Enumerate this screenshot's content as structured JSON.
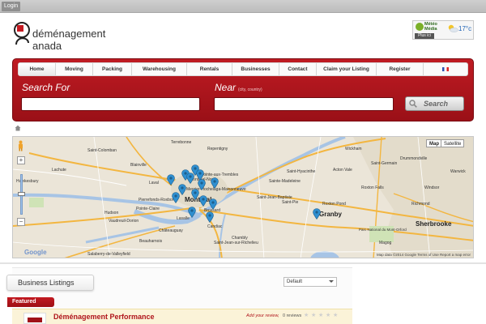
{
  "topbar": {
    "login_label": "Login"
  },
  "logo": {
    "line1": "déménagement",
    "line2": "anada"
  },
  "weather": {
    "brand": "Météo Média",
    "place": "Plus ici",
    "temperature": "17°c",
    "icon": "sun-cloud-icon"
  },
  "nav": {
    "items": [
      {
        "label": "Home",
        "active": true
      },
      {
        "label": "Moving",
        "active": false
      },
      {
        "label": "Packing",
        "active": false
      },
      {
        "label": "Warehousing",
        "active": false
      },
      {
        "label": "Rentals",
        "active": false
      },
      {
        "label": "Businesses",
        "active": false
      },
      {
        "label": "Contact",
        "active": false
      },
      {
        "label": "Claim your Listing",
        "active": false
      },
      {
        "label": "Register",
        "active": false
      }
    ],
    "language_icon": "french-flag-icon"
  },
  "search": {
    "search_for_label": "Search For",
    "search_for_value": "",
    "near_label": "Near",
    "near_hint": "(city, country)",
    "near_value": "",
    "button_label": "Search"
  },
  "map": {
    "type_map": "Map",
    "type_satellite": "Satellite",
    "selected_type": "Map",
    "footer": "Map data ©2014 Google    Terms of Use    Report a map error",
    "places": {
      "saint_colomban": "Saint-Colomban",
      "terrebonne": "Terrebonne",
      "repentigny": "Repentigny",
      "blainville": "Blainville",
      "lachute": "Lachute",
      "pointe_aux_trembles": "Pointe-aux-Trembles",
      "hawkesbury": "Hawkesbury",
      "laval": "Laval",
      "montreal_nord": "Montréal-Nord",
      "mercier": "Mercier-Hochelaga-Maisonneuve",
      "pierrefonds": "Pierrefonds-Roxboro",
      "montreal": "Montreal",
      "pointe_claire": "Pointe-Claire",
      "hudson": "Hudson",
      "vaudreuil": "Vaudreuil-Dorion",
      "lasalle": "Lasalle",
      "brossard": "Brossard",
      "chateauguay": "Châteauguay",
      "candiac": "Candiac",
      "chambly": "Chambly",
      "beauharnois": "Beauharnois",
      "valleyfield": "Salaberry-de-Valleyfield",
      "saint_jean": "Saint-Jean-sur-Richelieu",
      "saint_hyacinthe": "Saint-Hyacinthe",
      "saint_jean_baptiste": "Saint-Jean-Baptiste",
      "sainte_madeleine": "Sainte-Madeleine",
      "saint_pie": "Saint-Pie",
      "granby": "Granby",
      "roxton_pond": "Roxton Pond",
      "wickham": "Wickham",
      "acton_vale": "Acton Vale",
      "roxton_falls": "Roxton Falls",
      "windsor": "Windsor",
      "sherbrooke": "Sherbrooke",
      "saint_germain": "Saint-Germain",
      "drummondville": "Drummondville",
      "richmond": "Richmond",
      "magog": "Magog",
      "parc_national": "Parc National du Mont-Orford",
      "warwick": "Warwick"
    }
  },
  "listings": {
    "tab_label": "Business Listings",
    "sort_value": "Default",
    "featured_label": "Featured",
    "items": [
      {
        "title": "Déménagement Performance",
        "review_link": "Add your review,",
        "review_count": "0 reviews",
        "rating": 0
      }
    ]
  },
  "colors": {
    "brand_red": "#b0151c",
    "panel_red": "#bf1b23",
    "pin_blue": "#2f8fd0"
  }
}
